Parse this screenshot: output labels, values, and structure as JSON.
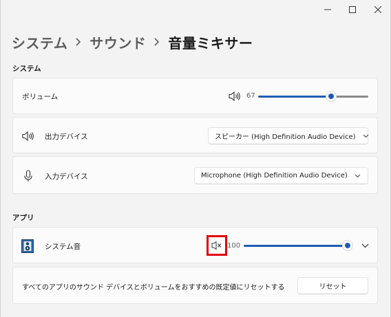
{
  "window": {
    "minimize_icon": "minimize-icon",
    "maximize_icon": "maximize-icon",
    "close_icon": "close-icon"
  },
  "breadcrumb": {
    "items": [
      "システム",
      "サウンド"
    ],
    "current": "音量ミキサー"
  },
  "system_section": {
    "label": "システム",
    "volume": {
      "label": "ボリューム",
      "value": "67",
      "level": 0.67,
      "icon": "speaker-icon"
    },
    "output": {
      "label": "出力デバイス",
      "icon": "speaker-icon",
      "selected": "スピーカー (High Definition Audio Device)"
    },
    "input": {
      "label": "入力デバイス",
      "icon": "microphone-icon",
      "selected": "Microphone (High Definition Audio Device)"
    }
  },
  "apps_section": {
    "label": "アプリ",
    "apps": [
      {
        "name": "システム音",
        "icon": "system-sounds-icon",
        "mute_icon": "speaker-muted-icon",
        "value": "100",
        "level": 1.0
      }
    ]
  },
  "reset": {
    "text": "すべてのアプリのサウンド デバイスとボリュームをおすすめの既定値にリセットする",
    "button_label": "リセット"
  },
  "colors": {
    "accent": "#1f5bb3",
    "highlight": "#e00000"
  }
}
